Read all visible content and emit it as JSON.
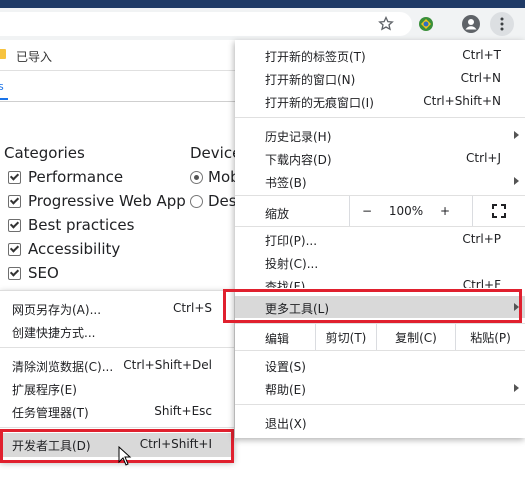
{
  "toolbar": {
    "icons": [
      "star-icon",
      "extension-icon",
      "profile-icon",
      "more-vert-icon"
    ]
  },
  "bookmarks_bar": {
    "folder_label": "已导入"
  },
  "devtools": {
    "tab_fragment": "s"
  },
  "lighthouse": {
    "categories_title": "Categories",
    "categories": [
      "Performance",
      "Progressive Web App",
      "Best practices",
      "Accessibility",
      "SEO"
    ],
    "device_title": "Device",
    "devices": [
      "Mob",
      "Des"
    ]
  },
  "more_tools_submenu": {
    "items": [
      {
        "label": "网页另存为(A)...",
        "shortcut": "Ctrl+S"
      },
      {
        "label": "创建快捷方式...",
        "shortcut": ""
      },
      {
        "label": "清除浏览数据(C)...",
        "shortcut": "Ctrl+Shift+Del"
      },
      {
        "label": "扩展程序(E)",
        "shortcut": ""
      },
      {
        "label": "任务管理器(T)",
        "shortcut": "Shift+Esc"
      },
      {
        "label": "开发者工具(D)",
        "shortcut": "Ctrl+Shift+I"
      }
    ]
  },
  "main_menu": {
    "items": [
      {
        "label": "打开新的标签页(T)",
        "shortcut": "Ctrl+T"
      },
      {
        "label": "打开新的窗口(N)",
        "shortcut": "Ctrl+N"
      },
      {
        "label": "打开新的无痕窗口(I)",
        "shortcut": "Ctrl+Shift+N"
      },
      {
        "label": "历史记录(H)",
        "shortcut": ""
      },
      {
        "label": "下载内容(D)",
        "shortcut": "Ctrl+J"
      },
      {
        "label": "书签(B)",
        "shortcut": ""
      },
      {
        "label": "打印(P)...",
        "shortcut": "Ctrl+P"
      },
      {
        "label": "投射(C)...",
        "shortcut": ""
      },
      {
        "label": "查找(F)...",
        "shortcut": "Ctrl+F"
      },
      {
        "label": "更多工具(L)",
        "shortcut": ""
      },
      {
        "label": "设置(S)",
        "shortcut": ""
      },
      {
        "label": "帮助(E)",
        "shortcut": ""
      },
      {
        "label": "退出(X)",
        "shortcut": ""
      }
    ],
    "zoom": {
      "label": "缩放",
      "minus": "−",
      "value": "100%",
      "plus": "+"
    },
    "edit": {
      "label": "编辑",
      "cut": "剪切(T)",
      "copy": "复制(C)",
      "paste": "粘贴(P)"
    }
  },
  "colors": {
    "highlight_box": "#e0202e",
    "accent": "#1a73e8"
  }
}
